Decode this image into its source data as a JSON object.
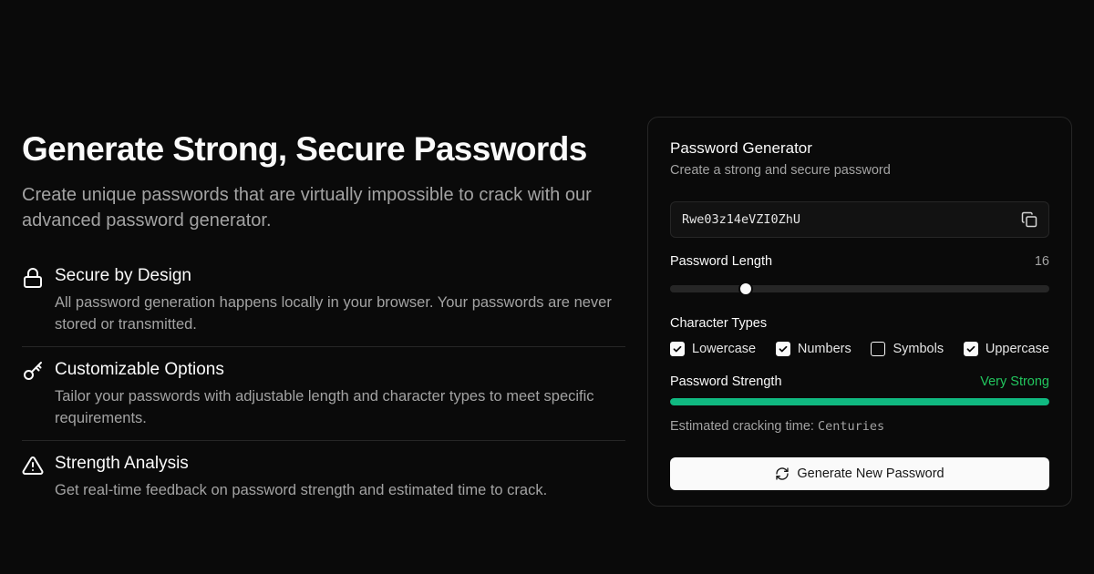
{
  "hero": {
    "title": "Generate Strong, Secure Passwords",
    "subtitle": "Create unique passwords that are virtually impossible to crack with our advanced password generator."
  },
  "features": [
    {
      "icon": "lock-icon",
      "title": "Secure by Design",
      "description": "All password generation happens locally in your browser. Your passwords are never stored or transmitted."
    },
    {
      "icon": "key-icon",
      "title": "Customizable Options",
      "description": "Tailor your passwords with adjustable length and character types to meet specific requirements."
    },
    {
      "icon": "warning-triangle-icon",
      "title": "Strength Analysis",
      "description": "Get real-time feedback on password strength and estimated time to crack."
    }
  ],
  "card": {
    "title": "Password Generator",
    "subtitle": "Create a strong and secure password",
    "password": "Rwe03z14eVZI0ZhU",
    "copy_icon": "copy-icon",
    "length_label": "Password Length",
    "length_value": "16",
    "length_slider": {
      "value": 16,
      "min": 4,
      "max": 64
    },
    "character_types_label": "Character Types",
    "character_types": [
      {
        "label": "Lowercase",
        "checked": true
      },
      {
        "label": "Numbers",
        "checked": true
      },
      {
        "label": "Symbols",
        "checked": false
      },
      {
        "label": "Uppercase",
        "checked": true
      }
    ],
    "strength_label": "Password Strength",
    "strength_value": "Very Strong",
    "strength_fraction": 1.0,
    "crack_label": "Estimated cracking time:",
    "crack_value": "Centuries",
    "generate_button": "Generate New Password",
    "generate_icon": "refresh-icon"
  },
  "colors": {
    "background": "#0a0a0a",
    "border": "#262626",
    "text": "#fafafa",
    "muted": "#a3a3a3",
    "strength_green": "#10b981",
    "strength_text": "#22c55e"
  }
}
